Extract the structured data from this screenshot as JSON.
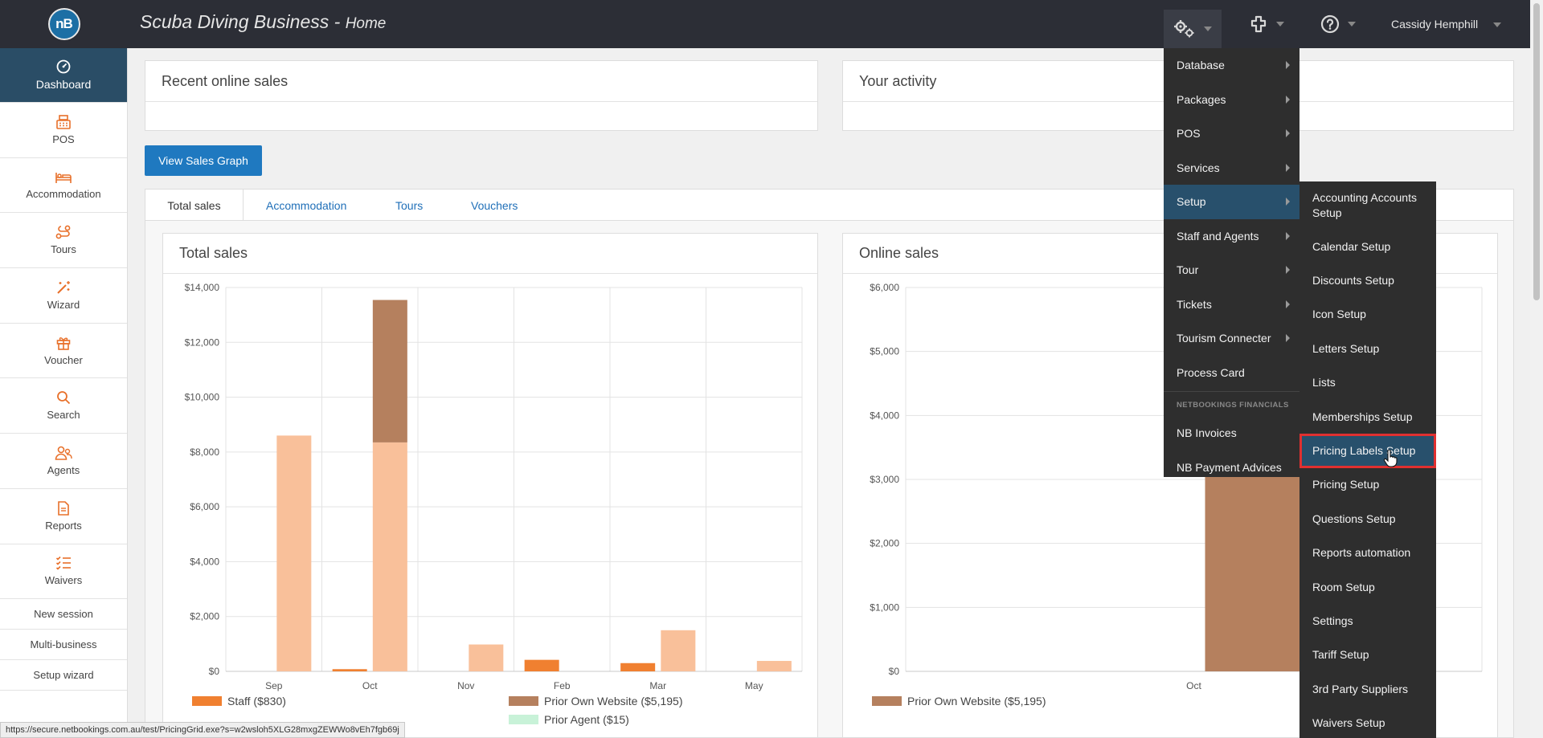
{
  "header": {
    "logo": "nB",
    "title": "Scuba Diving Business - ",
    "subtitle": "Home",
    "user": "Cassidy Hemphill"
  },
  "sidebar": {
    "items": [
      {
        "label": "Dashboard",
        "icon": "dashboard-icon"
      },
      {
        "label": "POS",
        "icon": "cash-register-icon"
      },
      {
        "label": "Accommodation",
        "icon": "bed-icon"
      },
      {
        "label": "Tours",
        "icon": "route-icon"
      },
      {
        "label": "Wizard",
        "icon": "magic-wand-icon"
      },
      {
        "label": "Voucher",
        "icon": "gift-icon"
      },
      {
        "label": "Search",
        "icon": "search-icon"
      },
      {
        "label": "Agents",
        "icon": "agents-icon"
      },
      {
        "label": "Reports",
        "icon": "report-icon"
      },
      {
        "label": "Waivers",
        "icon": "checklist-icon"
      }
    ],
    "links": [
      "New session",
      "Multi-business",
      "Setup wizard"
    ]
  },
  "panels": {
    "recent_online_sales": "Recent online sales",
    "your_activity": "Your activity"
  },
  "buttons": {
    "view_sales_graph": "View Sales Graph"
  },
  "tabs": [
    "Total sales",
    "Accommodation",
    "Tours",
    "Vouchers"
  ],
  "colors": {
    "staff": "#f08030",
    "prior_own_website": "#b5805e",
    "base_bar": "#f9c09a",
    "prior_agent": "#c8f2d8",
    "accent": "#1f79c0"
  },
  "chart_data": [
    {
      "type": "bar",
      "title": "Total sales",
      "categories": [
        "Sep",
        "Oct",
        "Nov",
        "Feb",
        "Mar",
        "May"
      ],
      "ylim": [
        0,
        14000
      ],
      "yticks": [
        "$0",
        "$2,000",
        "$4,000",
        "$6,000",
        "$8,000",
        "$10,000",
        "$12,000",
        "$14,000"
      ],
      "grid": true,
      "legend_position": "bottom",
      "series": [
        {
          "name": "Staff ($830)",
          "values": [
            0,
            80,
            0,
            420,
            300,
            0
          ]
        },
        {
          "name": "Prior Own Website ($5,195)",
          "values": [
            0,
            5195,
            0,
            0,
            0,
            0
          ]
        },
        {
          "values": [
            8600,
            8350,
            980,
            0,
            1500,
            380
          ]
        },
        {
          "name": "Prior Agent ($15)",
          "values": [
            0,
            0,
            0,
            0,
            0,
            0
          ]
        }
      ]
    },
    {
      "type": "bar",
      "title": "Online sales",
      "categories": [
        "Oct"
      ],
      "ylim": [
        0,
        6000
      ],
      "yticks": [
        "$0",
        "$1,000",
        "$2,000",
        "$3,000",
        "$4,000",
        "$5,000",
        "$6,000"
      ],
      "grid": true,
      "legend_position": "bottom",
      "series": [
        {
          "name": "Prior Own Website ($5,195)",
          "values": [
            5195
          ]
        }
      ]
    }
  ],
  "menu": {
    "items": [
      {
        "label": "Database",
        "submenu": true
      },
      {
        "label": "Packages",
        "submenu": true
      },
      {
        "label": "POS",
        "submenu": true
      },
      {
        "label": "Services",
        "submenu": true
      },
      {
        "label": "Setup",
        "submenu": true,
        "active": true
      },
      {
        "label": "Staff and Agents",
        "submenu": true
      },
      {
        "label": "Tour",
        "submenu": true
      },
      {
        "label": "Tickets",
        "submenu": true
      },
      {
        "label": "Tourism Connecter",
        "submenu": true
      },
      {
        "label": "Process Card",
        "submenu": false
      }
    ],
    "section": "NETBOOKINGS FINANCIALS",
    "financial_items": [
      "NB Invoices",
      "NB Payment Advices"
    ]
  },
  "setup_submenu": [
    "Accounting Accounts Setup",
    "Calendar Setup",
    "Discounts Setup",
    "Icon Setup",
    "Letters Setup",
    "Lists",
    "Memberships Setup",
    "Pricing Labels Setup",
    "Pricing Setup",
    "Questions Setup",
    "Reports automation",
    "Room Setup",
    "Settings",
    "Tariff Setup",
    "3rd Party Suppliers",
    "Waivers Setup"
  ],
  "status_url": "https://secure.netbookings.com.au/test/PricingGrid.exe?s=w2wsloh5XLG28mxgZEWWo8vEh7fgb69j"
}
